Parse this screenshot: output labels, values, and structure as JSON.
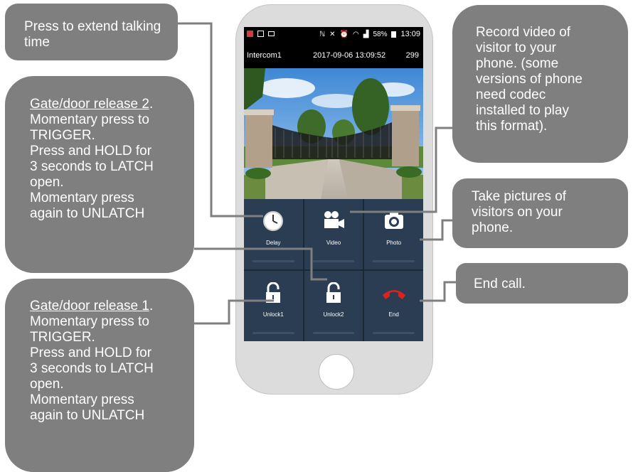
{
  "callouts": {
    "delay": "Press to extend talking time",
    "unlock2": {
      "title": "Gate/door release 2",
      "after_title": ".",
      "lines": [
        "Momentary press to",
        "TRIGGER.",
        "Press and HOLD for",
        "3 seconds to LATCH",
        "open.",
        "Momentary press",
        "again to UNLATCH"
      ]
    },
    "unlock1": {
      "title": "Gate/door release 1",
      "after_title": ".",
      "lines": [
        "Momentary press to",
        "TRIGGER.",
        "Press and HOLD for",
        "3 seconds to LATCH",
        "open.",
        "Momentary press",
        "again to UNLATCH"
      ]
    },
    "video": [
      "Record video of",
      "visitor to your",
      "phone. (some",
      "versions of phone",
      "need codec",
      "installed to play",
      "this format)."
    ],
    "photo": [
      "Take pictures of",
      "visitors on your",
      "phone."
    ],
    "end": "End call."
  },
  "status_bar": {
    "battery": "58%",
    "time": "13:09"
  },
  "info_bar": {
    "device": "Intercom1",
    "datetime": "2017-09-06  13:09:52",
    "counter": "299"
  },
  "buttons": [
    {
      "label": "Delay",
      "icon": "clock-icon"
    },
    {
      "label": "Video",
      "icon": "video-camera-icon"
    },
    {
      "label": "Photo",
      "icon": "camera-icon"
    },
    {
      "label": "Unlock1",
      "icon": "unlock-icon"
    },
    {
      "label": "Unlock2",
      "icon": "unlock-icon"
    },
    {
      "label": "End",
      "icon": "hangup-icon"
    }
  ],
  "colors": {
    "callout_bg": "#7f7f7f",
    "tile_bg": "#2a3d52",
    "end_red": "#d8231f"
  }
}
